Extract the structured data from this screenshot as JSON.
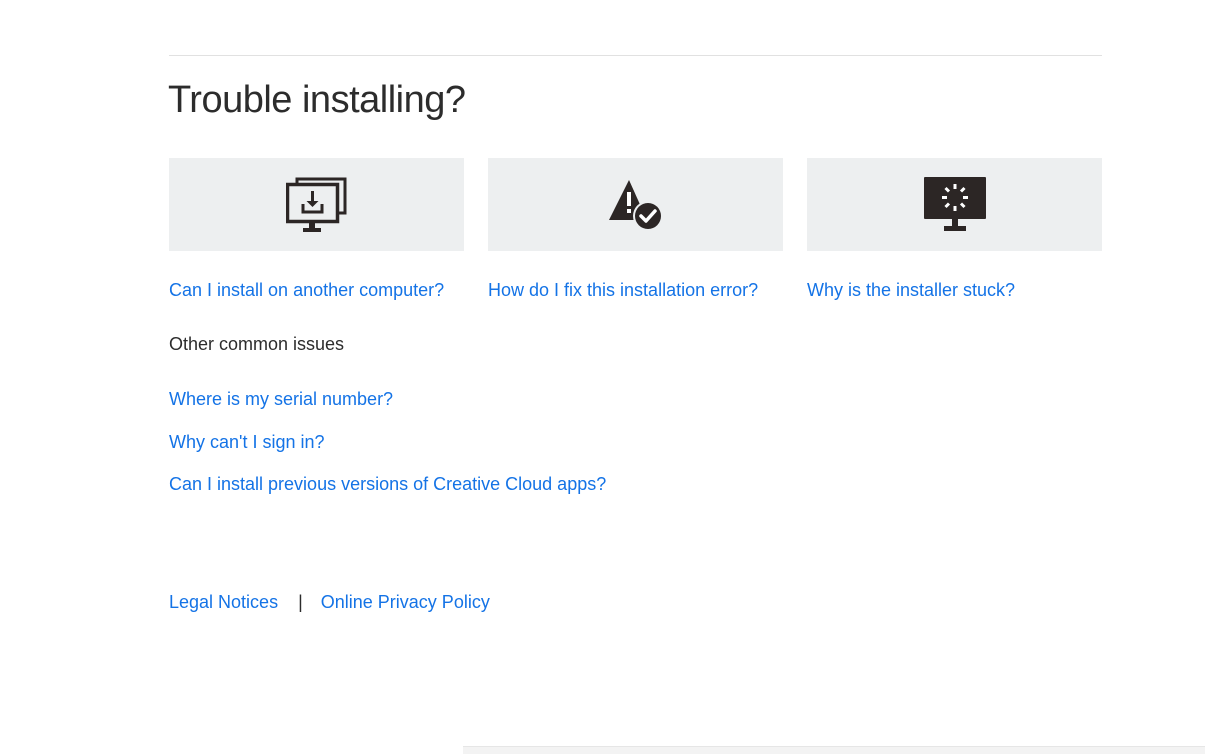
{
  "section": {
    "title": "Trouble installing?"
  },
  "cards": [
    {
      "icon": "install-on-multiple-computers-icon",
      "link": "Can I install on another computer?"
    },
    {
      "icon": "warning-with-checkmark-icon",
      "link": "How do I fix this installation error?"
    },
    {
      "icon": "monitor-loading-spinner-icon",
      "link": "Why is the installer stuck?"
    }
  ],
  "other": {
    "heading": "Other common issues",
    "links": [
      "Where is my serial number?",
      "Why can't I sign in?",
      "Can I install previous versions of Creative Cloud apps?"
    ]
  },
  "footer": {
    "legal": "Legal Notices",
    "separator": "|",
    "privacy": "Online Privacy Policy"
  },
  "colors": {
    "link": "#1473e6",
    "text": "#2c2c2c",
    "card_bg": "#edeff0",
    "icon": "#2c2625"
  }
}
